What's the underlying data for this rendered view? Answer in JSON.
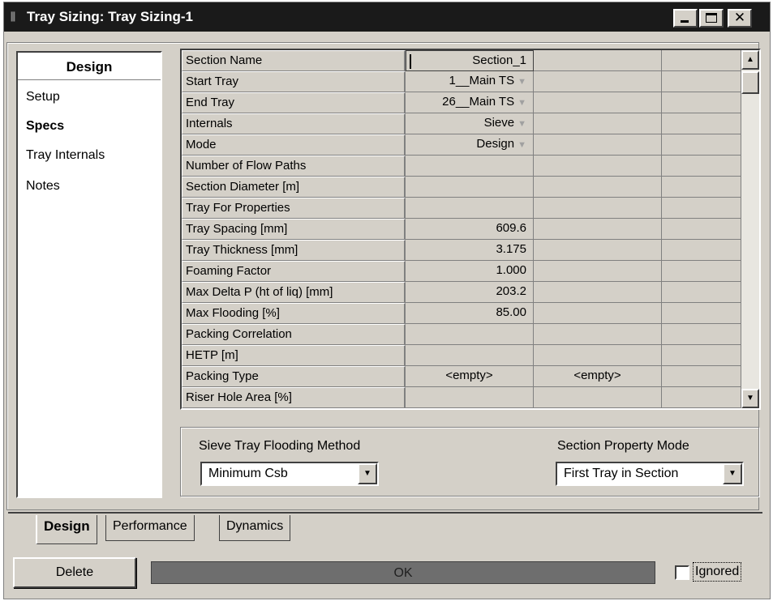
{
  "window": {
    "title": "Tray Sizing: Tray Sizing-1",
    "title_icon": "column-icon",
    "minimize": "_",
    "maximize": "□",
    "close": "✕"
  },
  "nav": {
    "heading": "Design",
    "items": [
      {
        "label": "Setup",
        "active": false
      },
      {
        "label": "Specs",
        "active": true
      },
      {
        "label": "Tray Internals",
        "active": false
      },
      {
        "label": "Notes",
        "active": false
      }
    ]
  },
  "grid": {
    "rows": [
      {
        "label": "Section Name",
        "v1": "Section_1",
        "dd": false
      },
      {
        "label": "Start Tray",
        "v1": "1__Main TS",
        "dd": true
      },
      {
        "label": "End Tray",
        "v1": "26__Main TS",
        "dd": true
      },
      {
        "label": "Internals",
        "v1": "Sieve",
        "dd": true
      },
      {
        "label": "Mode",
        "v1": "Design",
        "dd": true
      },
      {
        "label": "Number of Flow Paths",
        "v1": "",
        "dd": false
      },
      {
        "label": "Section Diameter [m]",
        "v1": "",
        "dd": false
      },
      {
        "label": "Tray For Properties",
        "v1": "",
        "dd": false
      },
      {
        "label": "Tray Spacing [mm]",
        "v1": "609.6",
        "dd": false
      },
      {
        "label": "Tray Thickness [mm]",
        "v1": "3.175",
        "dd": false
      },
      {
        "label": "Foaming Factor",
        "v1": "1.000",
        "dd": false
      },
      {
        "label": "Max Delta P (ht of liq) [mm]",
        "v1": "203.2",
        "dd": false
      },
      {
        "label": "Max Flooding [%]",
        "v1": "85.00",
        "dd": false
      },
      {
        "label": "Packing Correlation",
        "v1": "",
        "dd": false
      },
      {
        "label": "HETP [m]",
        "v1": "",
        "dd": false
      },
      {
        "label": "Packing Type",
        "v1": "<empty>",
        "v2": "<empty>",
        "dd": false
      },
      {
        "label": "Riser Hole Area  [%]",
        "v1": "",
        "dd": false
      }
    ]
  },
  "options": {
    "flooding_method_label": "Sieve Tray Flooding Method",
    "flooding_method_value": "Minimum Csb",
    "property_mode_label": "Section Property Mode",
    "property_mode_value": "First Tray in Section"
  },
  "tabs": [
    {
      "label": "Design",
      "active": true
    },
    {
      "label": "Performance",
      "active": false
    },
    {
      "label": "Dynamics",
      "active": false
    }
  ],
  "footer": {
    "delete_label": "Delete",
    "status_text": "OK",
    "ignored_label": "Ignored",
    "ignored_checked": false
  },
  "colors": {
    "status_bar": "#6e6e6e",
    "titlebar": "#1a1a1a",
    "face": "#d4d0c8"
  }
}
